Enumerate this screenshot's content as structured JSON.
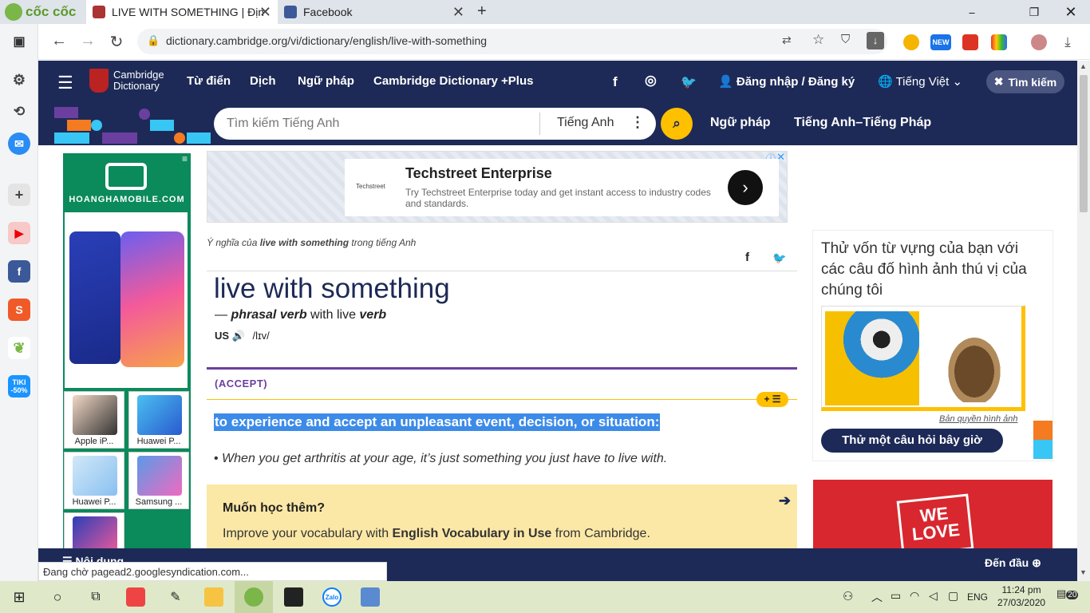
{
  "browser": {
    "brand": "cốc cốc",
    "tabs": [
      {
        "title": "LIVE WITH SOMETHING | Định",
        "active": true
      },
      {
        "title": "Facebook",
        "active": false
      }
    ],
    "url": "dictionary.cambridge.org/vi/dictionary/english/live-with-something",
    "new_badge": "NEW"
  },
  "sidebar_apps": {
    "tiki": "TIKI",
    "tiki_sale": "-50%"
  },
  "site": {
    "logo_line1": "Cambridge",
    "logo_line2": "Dictionary",
    "nav": [
      "Từ điển",
      "Dịch",
      "Ngữ pháp",
      "Cambridge Dictionary +Plus"
    ],
    "login": "Đăng nhập / Đăng ký",
    "language": "Tiếng Việt",
    "search_close": "Tìm kiếm",
    "search_placeholder": "Tìm kiếm Tiếng Anh",
    "search_lang": "Tiếng Anh",
    "sub_links": [
      "Ngữ pháp",
      "Tiếng Anh–Tiếng Pháp"
    ]
  },
  "ad_top": {
    "title": "Techstreet Enterprise",
    "body": "Try Techstreet Enterprise today and get instant access to industry codes and standards.",
    "logo": "Techstreet"
  },
  "ad_left": {
    "brand": "HOANGHAMOBILE.COM",
    "products": [
      "Apple iP...",
      "Huawei P...",
      "Huawei P...",
      "Samsung ..."
    ]
  },
  "entry": {
    "meaning_prefix": "Ý nghĩa của ",
    "meaning_word": "live with something",
    "meaning_suffix": " trong tiếng Anh",
    "headword": "live with something",
    "dash": "— ",
    "pos": "phrasal verb",
    "with_text": " with live ",
    "pos2": "verb",
    "region": "US",
    "ipa": "/lɪv/",
    "guide": "(ACCEPT)",
    "definition": "to experience and accept an unpleasant event, decision, or situation:",
    "example": "When you get arthritis at your age, it’s just something you just have to live with.",
    "learn_title": "Muốn học thêm?",
    "learn_pre": "Improve your vocabulary with ",
    "learn_bold": "English Vocabulary in Use",
    "learn_post": " from Cambridge."
  },
  "quiz": {
    "title": "Thử vốn từ vựng của bạn với các câu đố hình ảnh thú vị của chúng tôi",
    "copyright": "Bản quyền hình ảnh",
    "button": "Thử một câu hỏi bây giờ"
  },
  "ad_right": {
    "text1": "WE",
    "text2": "LOVE"
  },
  "bottom": {
    "left": "Nội dung",
    "back_to_top": "Đến đầu"
  },
  "status_text": "Đang chờ pagead2.googlesyndication.com...",
  "taskbar": {
    "lang": "ENG",
    "time": "11:24 pm",
    "date": "27/03/2020",
    "notif": "20",
    "zalo": "Zalo"
  },
  "colors": {
    "nav_bg": "#1d2a57",
    "accent_yellow": "#ffc000",
    "purple": "#6b3fa0"
  }
}
